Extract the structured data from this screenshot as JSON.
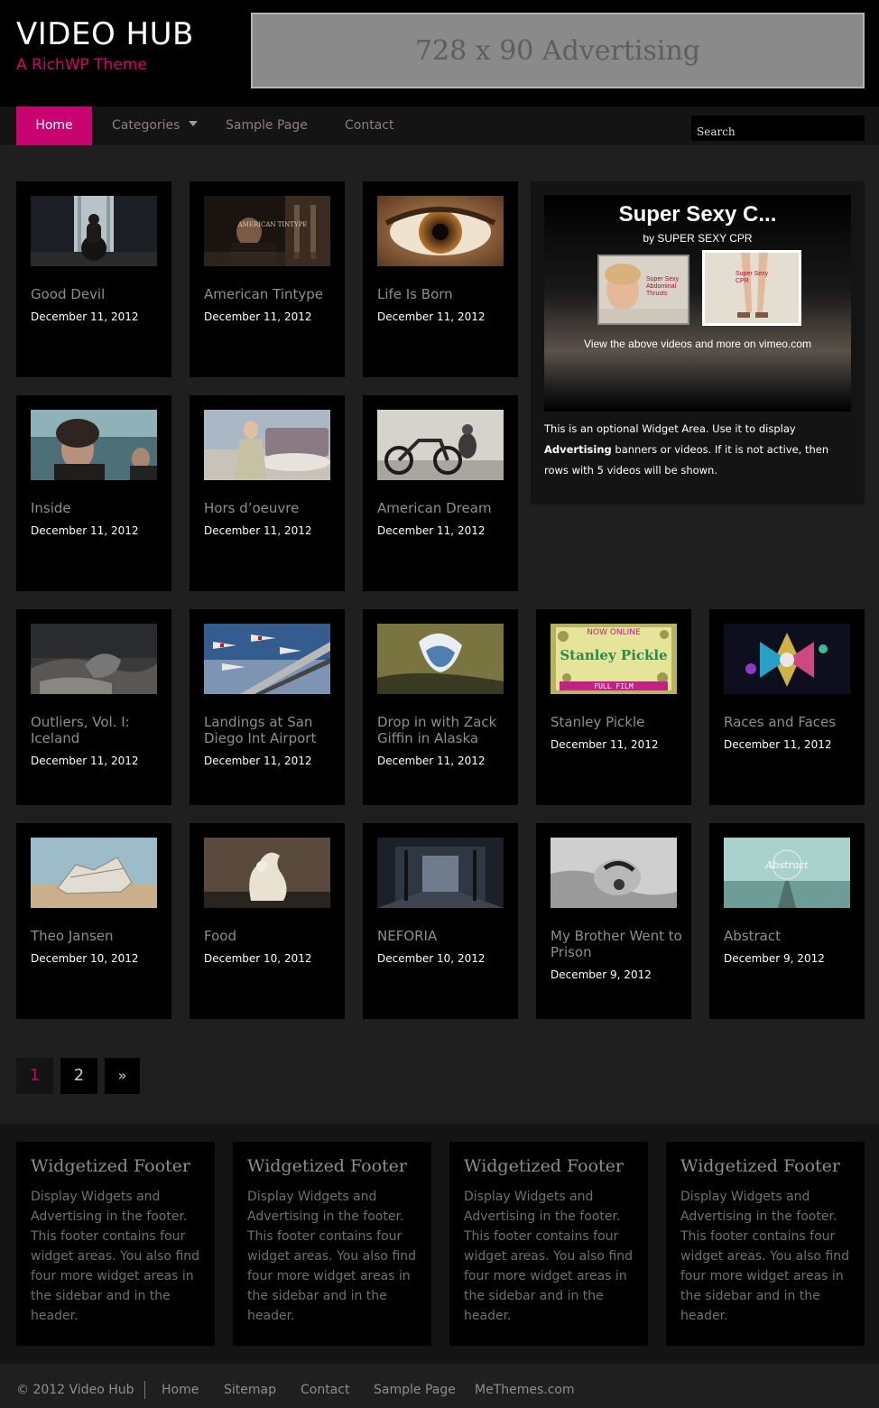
{
  "header": {
    "site_title": "VIDEO HUB",
    "tagline": "A RichWP Theme",
    "ad_text": "728 x 90 Advertising"
  },
  "nav": {
    "items": [
      {
        "label": "Home",
        "active": true
      },
      {
        "label": "Categories",
        "has_dropdown": true
      },
      {
        "label": "Sample Page"
      },
      {
        "label": "Contact"
      }
    ],
    "search_placeholder": "Search",
    "active_color": "#c8036f"
  },
  "videos": [
    {
      "title": "Good Devil",
      "date": "December 11, 2012"
    },
    {
      "title": "American Tintype",
      "date": "December 11, 2012"
    },
    {
      "title": "Life Is Born",
      "date": "December 11, 2012"
    },
    {
      "title": "Inside",
      "date": "December 11, 2012"
    },
    {
      "title": "Hors d’oeuvre",
      "date": "December 11, 2012"
    },
    {
      "title": "American Dream",
      "date": "December 11, 2012"
    },
    {
      "title": "Outliers, Vol. I: Iceland",
      "date": "December 11, 2012"
    },
    {
      "title": "Landings at San Diego Int Airport",
      "date": "December 11, 2012"
    },
    {
      "title": "Drop in with Zack Giffin in Alaska",
      "date": "December 11, 2012"
    },
    {
      "title": "Stanley Pickle",
      "date": "December 11, 2012"
    },
    {
      "title": "Races and Faces",
      "date": "December 11, 2012"
    },
    {
      "title": "Theo Jansen",
      "date": "December 10, 2012"
    },
    {
      "title": "Food",
      "date": "December 10, 2012"
    },
    {
      "title": "NEFORIA",
      "date": "December 10, 2012"
    },
    {
      "title": "My Brother Went to Prison",
      "date": "December 9, 2012"
    },
    {
      "title": "Abstract",
      "date": "December 9, 2012"
    }
  ],
  "thumb_text": {
    "tintype": "AMERICAN TINTYPE",
    "pickle_top": "NOW ONLINE",
    "pickle_name": "Stanley Pickle",
    "pickle_bottom": "FULL FILM",
    "abstract": "Abstract"
  },
  "widget": {
    "vimeo_title": "Super Sexy C...",
    "vimeo_by": "by SUPER SEXY CPR",
    "thumb1_caption": "Super Sexy Abdominal Thrusts",
    "thumb2_caption": "Super Sexy CPR",
    "view_more": "View the above videos and more on vimeo.com",
    "text_before": "This is an optional Widget Area. Use it to display ",
    "text_bold": "Advertising",
    "text_after": " banners or videos. If it is not active, then rows with 5 videos will be shown."
  },
  "pagination": {
    "pages": [
      "1",
      "2"
    ],
    "next": "»",
    "current": "1"
  },
  "footer_widgets": [
    {
      "title": "Widgetized Footer",
      "body": "Display Widgets and Advertising in the footer. This footer contains four widget areas. You also find four more widget areas in the sidebar and in the header."
    },
    {
      "title": "Widgetized Footer",
      "body": "Display Widgets and Advertising in the footer. This footer contains four widget areas. You also find four more widget areas in the sidebar and in the header."
    },
    {
      "title": "Widgetized Footer",
      "body": "Display Widgets and Advertising in the footer. This footer contains four widget areas. You also find four more widget areas in the sidebar and in the header."
    },
    {
      "title": "Widgetized Footer",
      "body": "Display Widgets and Advertising in the footer. This footer contains four widget areas. You also find four more widget areas in the sidebar and in the header."
    }
  ],
  "bottom_bar": {
    "copyright": "© 2012 Video Hub",
    "links": [
      "Home",
      "Sitemap",
      "Contact",
      "Sample Page",
      "MeThemes.com"
    ]
  }
}
